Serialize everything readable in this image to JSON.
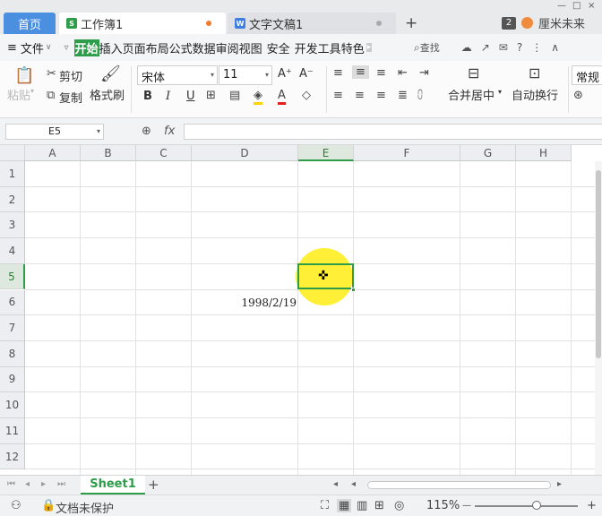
{
  "titlebar": {
    "home_tab": "首页",
    "tabs": [
      {
        "label": "工作簿1",
        "icon": "S",
        "icon_color": "#2e9d4a",
        "dot_color": "#f07a2e",
        "active": true
      },
      {
        "label": "文字文稿1",
        "icon": "W",
        "icon_color": "#3d7ee0",
        "dot_color": "#aaaaaa",
        "active": false
      }
    ],
    "add_tab": "+",
    "badge": "2",
    "user_name": "厘米未来",
    "window_controls": [
      "—",
      "□",
      "×"
    ]
  },
  "menubar": {
    "file_label": "文件",
    "items": [
      "开始",
      "插入",
      "页面布局",
      "公式",
      "数据",
      "审阅",
      "视图",
      "安全",
      "开发工具",
      "特色"
    ],
    "active_item": "开始",
    "search_label": "查找",
    "help": "?",
    "more": "⋮",
    "collapse": "∧"
  },
  "ribbon": {
    "paste_label": "粘贴",
    "cut_label": "剪切",
    "copy_label": "复制",
    "format_painter_label": "格式刷",
    "font_name": "宋体",
    "font_size": "11",
    "grow_font": "A⁺",
    "shrink_font": "A⁻",
    "bold": "B",
    "italic": "I",
    "underline": "U",
    "merge_label": "合并居中",
    "wrap_label": "自动换行",
    "number_format": "常规"
  },
  "formula_bar": {
    "cell_ref": "E5",
    "fx_label": "fx",
    "formula": ""
  },
  "grid": {
    "columns": [
      "A",
      "B",
      "C",
      "D",
      "E",
      "F",
      "G",
      "H"
    ],
    "rows": [
      "1",
      "2",
      "3",
      "4",
      "5",
      "6",
      "7",
      "8",
      "9",
      "10",
      "11",
      "12"
    ],
    "selected_column": "E",
    "selected_row": "5",
    "cells": {
      "D6": "1998/2/19"
    },
    "highlight_color": "#ffec14",
    "selection_color": "#2e9d4a"
  },
  "sheets": {
    "tabs": [
      "Sheet1"
    ],
    "add": "+"
  },
  "statusbar": {
    "protection_label": "文档未保护",
    "zoom_label": "115%",
    "zoom_minus": "—",
    "zoom_plus": "+",
    "zoom_fraction": 0.6
  }
}
